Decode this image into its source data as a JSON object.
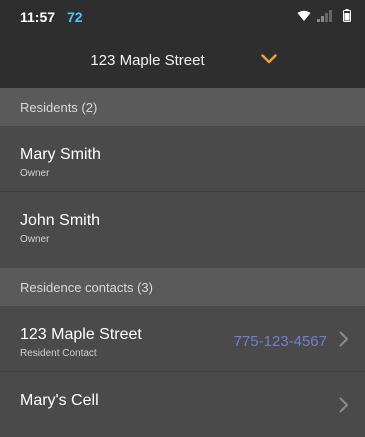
{
  "status_bar": {
    "time": "11:57",
    "badge": "72",
    "icons": [
      "wifi-icon",
      "signal-icon",
      "battery-icon"
    ]
  },
  "header": {
    "title": "123 Maple Street",
    "accent_color": "#f0a040"
  },
  "residents": {
    "section_label": "Residents (2)",
    "items": [
      {
        "name": "Mary Smith",
        "role": "Owner"
      },
      {
        "name": "John Smith",
        "role": "Owner"
      }
    ]
  },
  "contacts": {
    "section_label": "Residence contacts (3)",
    "items": [
      {
        "name": "123 Maple Street",
        "role": "Resident Contact",
        "phone": "775-123-4567"
      },
      {
        "name": "Mary's Cell",
        "role": "",
        "phone": ""
      }
    ]
  },
  "colors": {
    "background": "#4a4a4a",
    "header_bg": "#2e2e2e",
    "section_bg": "#5a5a5a",
    "phone_link": "#6f7fd1"
  }
}
